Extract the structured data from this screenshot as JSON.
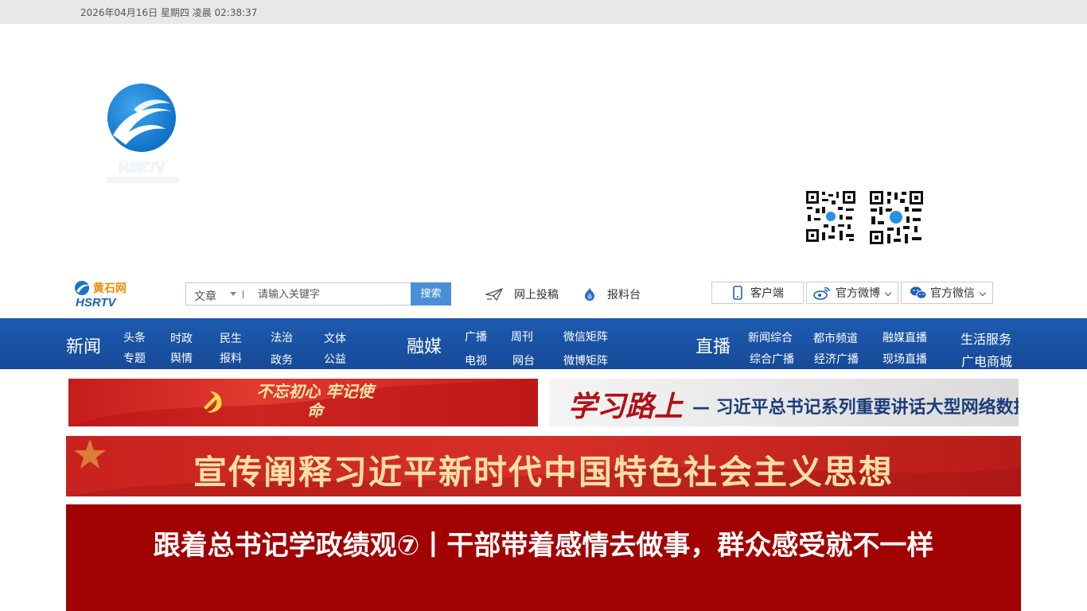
{
  "topbar": {
    "datetime": "2026年04月16日 星期四 凌晨 02:38:37"
  },
  "logo": {
    "name": "HSRTV"
  },
  "search": {
    "type_label": "文章",
    "placeholder": "请输入关键字",
    "button_label": "搜索"
  },
  "tools": {
    "post_label": "网上投稿",
    "report_label": "报料台"
  },
  "buttons": {
    "client_label": "客户端",
    "weibo_label": "官方微博",
    "wechat_label": "官方微信"
  },
  "nav": {
    "news": {
      "title": "新闻",
      "items": [
        "头条",
        "专题",
        "时政",
        "舆情",
        "民生",
        "报料",
        "法治",
        "政务",
        "文体",
        "公益"
      ]
    },
    "media": {
      "title": "融媒",
      "items": [
        "广播",
        "电视",
        "周刊",
        "网台",
        "微信矩阵",
        "微博矩阵"
      ]
    },
    "live": {
      "title": "直播",
      "items": [
        "新闻综合",
        "综合广播",
        "都市频道",
        "经济广播",
        "融媒直播",
        "现场直播"
      ]
    },
    "service": {
      "items": [
        "生活服务",
        "广电商城"
      ]
    }
  },
  "banners": {
    "b1": "不忘初心 牢记使命",
    "b2_title": "学习路上",
    "b2_sub": "— 习近平总书记系列重要讲话大型网络数据库",
    "b3": "宣传阐释习近平新时代中国特色社会主义思想"
  },
  "headline": "跟着总书记学政绩观⑦丨干部带着感情去做事，群众感受就不一样",
  "colors": {
    "nav_blue": "#1e5bb0",
    "headline_red": "#a10101",
    "search_button": "#4a8fd6"
  }
}
